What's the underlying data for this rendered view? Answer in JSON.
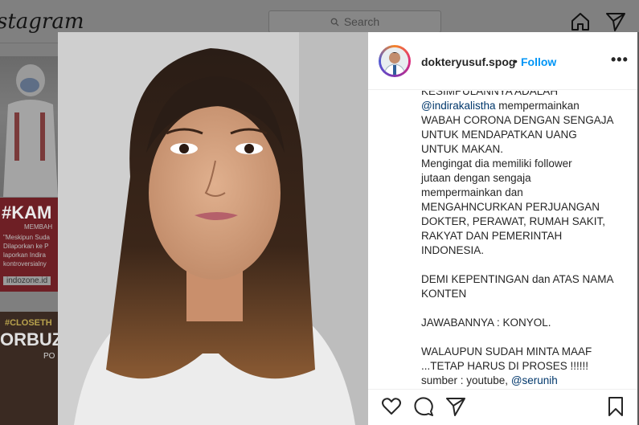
{
  "background": {
    "logo_text": "stagram",
    "search_placeholder": "Search",
    "post2": {
      "headline": "#KAM",
      "subhead": "MEMBAH",
      "lines": [
        "\"Meskipun Suda",
        "Dilaporkan ke P",
        "laporkan Indira",
        "kontroversialny"
      ],
      "source": "indozone.id"
    },
    "post3": {
      "tag": "#CLOSETH",
      "headline": "ORBUZ",
      "sub": "PO"
    }
  },
  "post": {
    "username": "dokteryusuf.spog",
    "separator": "•",
    "follow_label": "Follow",
    "more_label": "•••",
    "caption_lines": [
      {
        "text": "KESIMPULANNYA ADALAH"
      },
      {
        "mention": "@indirakalistha",
        "text": " mempermainkan"
      },
      {
        "text": "WABAH CORONA DENGAN SENGAJA"
      },
      {
        "text": "UNTUK MENDAPATKAN UANG"
      },
      {
        "text": "UNTUK MAKAN."
      },
      {
        "text": "Mengingat dia memiliki follower"
      },
      {
        "text": "jutaan dengan sengaja"
      },
      {
        "text": "mempermainkan dan"
      },
      {
        "text": "MENGAHNCURKAN PERJUANGAN"
      },
      {
        "text": "DOKTER, PERAWAT, RUMAH SAKIT,"
      },
      {
        "text": "RAKYAT DAN PEMERINTAH"
      },
      {
        "text": "INDONESIA."
      },
      {
        "text": ""
      },
      {
        "text": "DEMI KEPENTINGAN dan ATAS NAMA"
      },
      {
        "text": "KONTEN"
      },
      {
        "text": ""
      },
      {
        "text": "JAWABANNYA : KONYOL."
      },
      {
        "text": ""
      },
      {
        "text": "WALAUPUN SUDAH MINTA MAAF"
      },
      {
        "text": "...TETAP HARUS DI PROSES !!!!!!"
      },
      {
        "text": "sumber : youtube, ",
        "mention_after": "@serunih"
      }
    ]
  },
  "icons": {
    "home": "home-icon",
    "direct": "paper-plane-icon",
    "like": "heart-icon",
    "comment": "comment-icon",
    "share": "share-icon",
    "save": "bookmark-icon",
    "search": "search-icon",
    "more": "more-options-icon"
  },
  "colors": {
    "follow": "#0095f6",
    "mention": "#00376b",
    "text": "#262626",
    "overlay": "#7f7f7f"
  }
}
